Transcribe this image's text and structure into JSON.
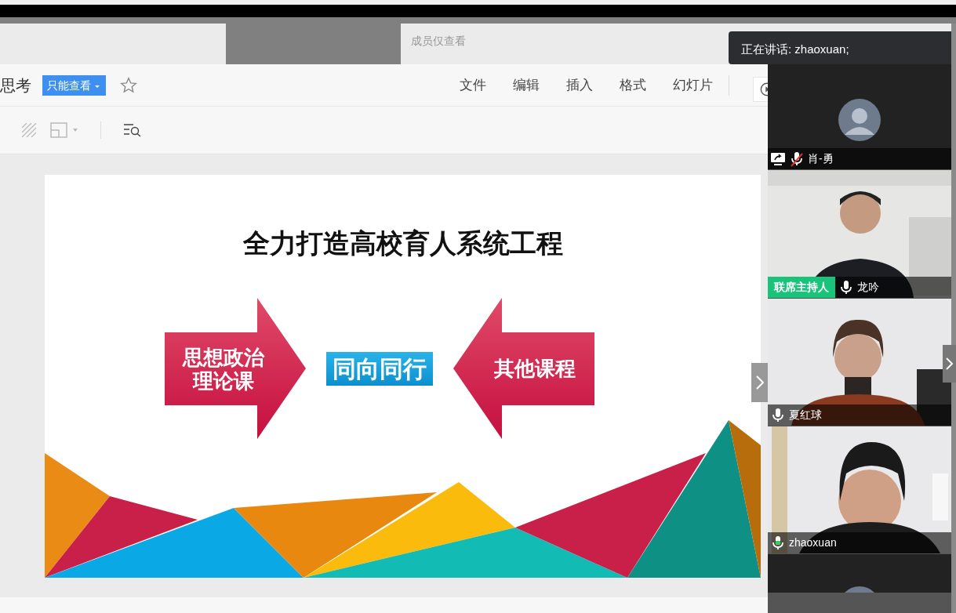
{
  "tabs": [
    {
      "label": "成员仅查看"
    }
  ],
  "document": {
    "title": "思考",
    "permission": "只能查看",
    "starred": false,
    "menu": [
      "文件",
      "编辑",
      "插入",
      "格式",
      "幻灯片"
    ]
  },
  "slide": {
    "title": "全力打造高校育人系统工程",
    "left_arrow": [
      "思想政治",
      "理论课"
    ],
    "center": "同向同行",
    "right_arrow": "其他课程"
  },
  "speaking_notice": "正在讲话: zhaoxuan;",
  "participants": [
    {
      "name": "肖-勇",
      "video": false,
      "muted": true,
      "sharing": true,
      "speaking": false
    },
    {
      "name": "龙吟",
      "badge": "联席主持人",
      "video": true,
      "muted": false,
      "sharing": false,
      "speaking": false
    },
    {
      "name": "夏红球",
      "video": true,
      "muted": false,
      "sharing": false,
      "speaking": false
    },
    {
      "name": "zhaoxuan",
      "video": true,
      "muted": false,
      "sharing": false,
      "speaking": true
    },
    {
      "video": false
    }
  ]
}
